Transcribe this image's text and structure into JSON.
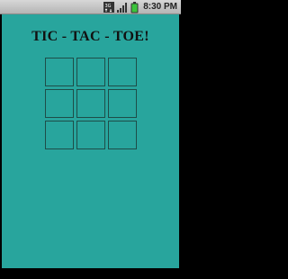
{
  "status_bar": {
    "time": "8:30 PM",
    "icons": [
      "data-connection-icon",
      "signal-icon",
      "battery-icon"
    ]
  },
  "app": {
    "title": "TIC - TAC - TOE!",
    "background_color": "#28a59d",
    "grid_line_color": "#1e4d49"
  },
  "board": {
    "rows": 3,
    "cols": 3,
    "cells": [
      "",
      "",
      "",
      "",
      "",
      "",
      "",
      "",
      ""
    ]
  }
}
